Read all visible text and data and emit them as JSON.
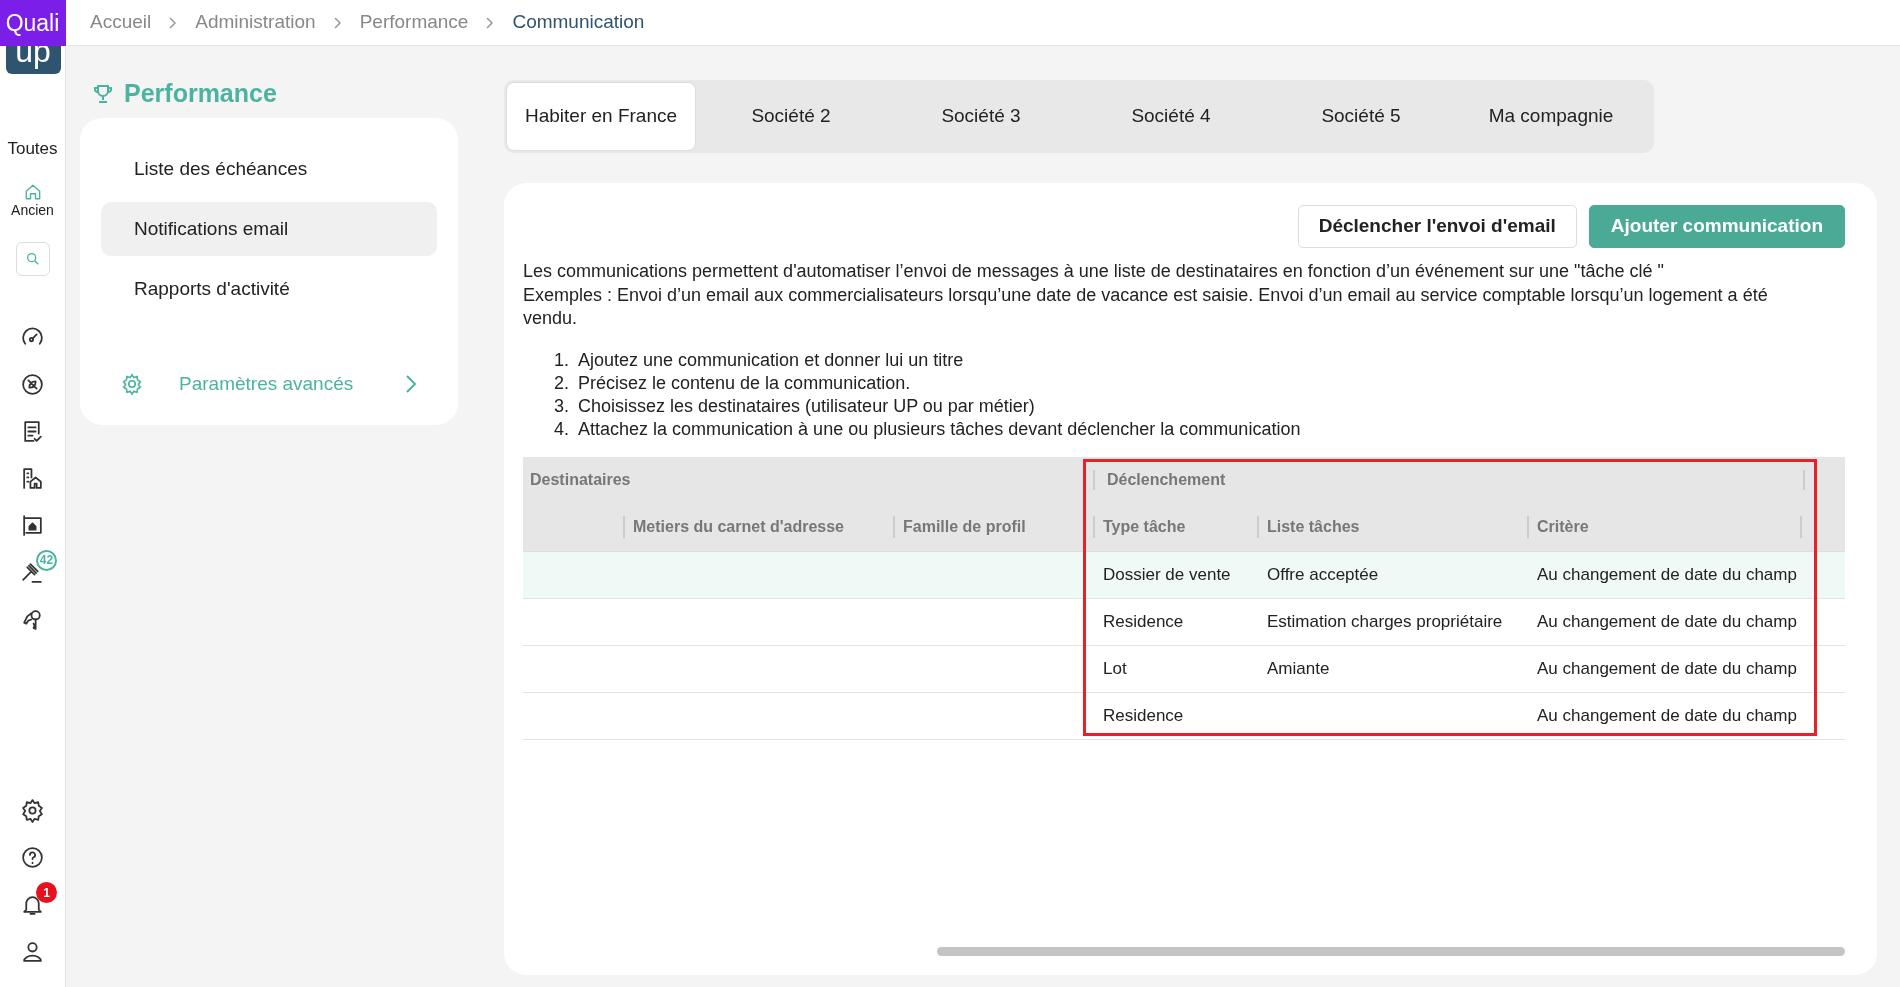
{
  "logo": {
    "top": "Quali",
    "bottom": "up"
  },
  "breadcrumb": [
    {
      "label": "Accueil",
      "current": false
    },
    {
      "label": "Administration",
      "current": false
    },
    {
      "label": "Performance",
      "current": false
    },
    {
      "label": "Communication",
      "current": true
    }
  ],
  "rail": {
    "label": "Toutes",
    "items": [
      {
        "kind": "home",
        "label": "Ancien"
      },
      {
        "kind": "search"
      },
      {
        "kind": "gauge"
      },
      {
        "kind": "compass"
      },
      {
        "kind": "checklist"
      },
      {
        "kind": "buildings"
      },
      {
        "kind": "sign"
      },
      {
        "kind": "gavel",
        "badge": "42"
      },
      {
        "kind": "keys"
      },
      {
        "kind": "spacer"
      },
      {
        "kind": "gear"
      },
      {
        "kind": "help"
      },
      {
        "kind": "bell",
        "badge": "1"
      },
      {
        "kind": "user"
      }
    ]
  },
  "section": {
    "title": "Performance",
    "items": [
      {
        "label": "Liste des échéances",
        "selected": false
      },
      {
        "label": "Notifications email",
        "selected": true
      },
      {
        "label": "Rapports d'activité",
        "selected": false
      }
    ],
    "advanced": "Paramètres avancés"
  },
  "tabs": [
    {
      "label": "Habiter en France",
      "selected": true
    },
    {
      "label": "Société 2",
      "selected": false
    },
    {
      "label": "Société 3",
      "selected": false
    },
    {
      "label": "Société 4",
      "selected": false
    },
    {
      "label": "Société 5",
      "selected": false
    },
    {
      "label": "Ma compagnie",
      "selected": false
    }
  ],
  "buttons": [
    {
      "label": "Déclencher l'envoi d'email",
      "kind": "secondary"
    },
    {
      "label": "Ajouter communication",
      "kind": "primary"
    }
  ],
  "description": [
    "Les communications permettent d'automatiser l’envoi de messages à une liste de destinataires en fonction d’un événement sur une \"tâche clé \"",
    "Exemples : Envoi d’un email aux commercialisateurs lorsqu’une date de vacance est saisie. Envoi d’un email au service comptable lorsqu’un logement a été vendu."
  ],
  "steps": [
    {
      "number": "1.",
      "text": "Ajoutez une communication et donner lui un titre"
    },
    {
      "number": "2.",
      "text": "Précisez le contenu de la communication."
    },
    {
      "number": "3.",
      "text": "Choisissez les destinataires (utilisateur UP ou par métier)"
    },
    {
      "number": "4.",
      "text": "Attachez la communication à une ou plusieurs tâches devant déclencher la communication"
    }
  ],
  "table": {
    "groups": [
      "Destinataires",
      "Déclenchement"
    ],
    "columns": [
      "",
      "Metiers du carnet d'adresse",
      "Famille de profil",
      "Type tâche",
      "Liste tâches",
      "Critère"
    ],
    "rows": [
      {
        "selected": true,
        "cells": [
          "",
          "",
          "",
          "Dossier de vente",
          "Offre acceptée",
          "Au changement de date du champ"
        ]
      },
      {
        "selected": false,
        "cells": [
          "",
          "",
          "",
          "Residence",
          "Estimation charges propriétaire",
          "Au changement de date du champ"
        ]
      },
      {
        "selected": false,
        "cells": [
          "",
          "",
          "",
          "Lot",
          "Amiante",
          "Au changement de date du champ"
        ]
      },
      {
        "selected": false,
        "cells": [
          "",
          "",
          "",
          "Residence",
          "",
          "Au changement de date du champ"
        ]
      }
    ]
  }
}
